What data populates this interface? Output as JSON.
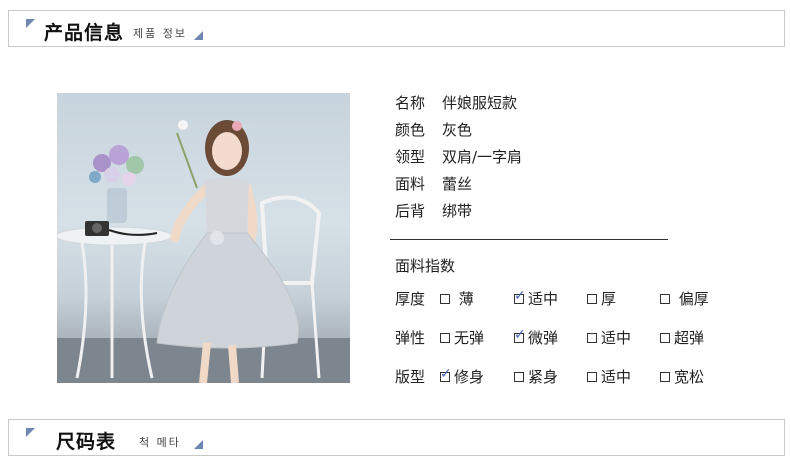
{
  "header_product": {
    "title": "产品信息",
    "subtitle": "제품 정보"
  },
  "header_size": {
    "title": "尺码表",
    "subtitle": "척 메타"
  },
  "product_info": [
    {
      "label": "名称",
      "value": "伴娘服短款"
    },
    {
      "label": "颜色",
      "value": "灰色"
    },
    {
      "label": "领型",
      "value": "双肩/一字肩"
    },
    {
      "label": "面料",
      "value": "蕾丝"
    },
    {
      "label": "后背",
      "value": "绑带"
    }
  ],
  "fabric_index": {
    "title": "面料指数",
    "rows": [
      {
        "label": "厚度",
        "options": [
          {
            "text": "薄",
            "checked": false
          },
          {
            "text": "适中",
            "checked": true
          },
          {
            "text": "厚",
            "checked": false
          },
          {
            "text": "偏厚",
            "checked": false
          }
        ]
      },
      {
        "label": "弹性",
        "options": [
          {
            "text": "无弹",
            "checked": false
          },
          {
            "text": "微弹",
            "checked": true
          },
          {
            "text": "适中",
            "checked": false
          },
          {
            "text": "超弹",
            "checked": false
          }
        ]
      },
      {
        "label": "版型",
        "options": [
          {
            "text": "修身",
            "checked": true
          },
          {
            "text": "紧身",
            "checked": false
          },
          {
            "text": "适中",
            "checked": false
          },
          {
            "text": "宽松",
            "checked": false
          }
        ]
      }
    ]
  },
  "colors": {
    "accent": "#6f86b3",
    "check": "#4a63b8",
    "border": "#c9c9c9"
  }
}
